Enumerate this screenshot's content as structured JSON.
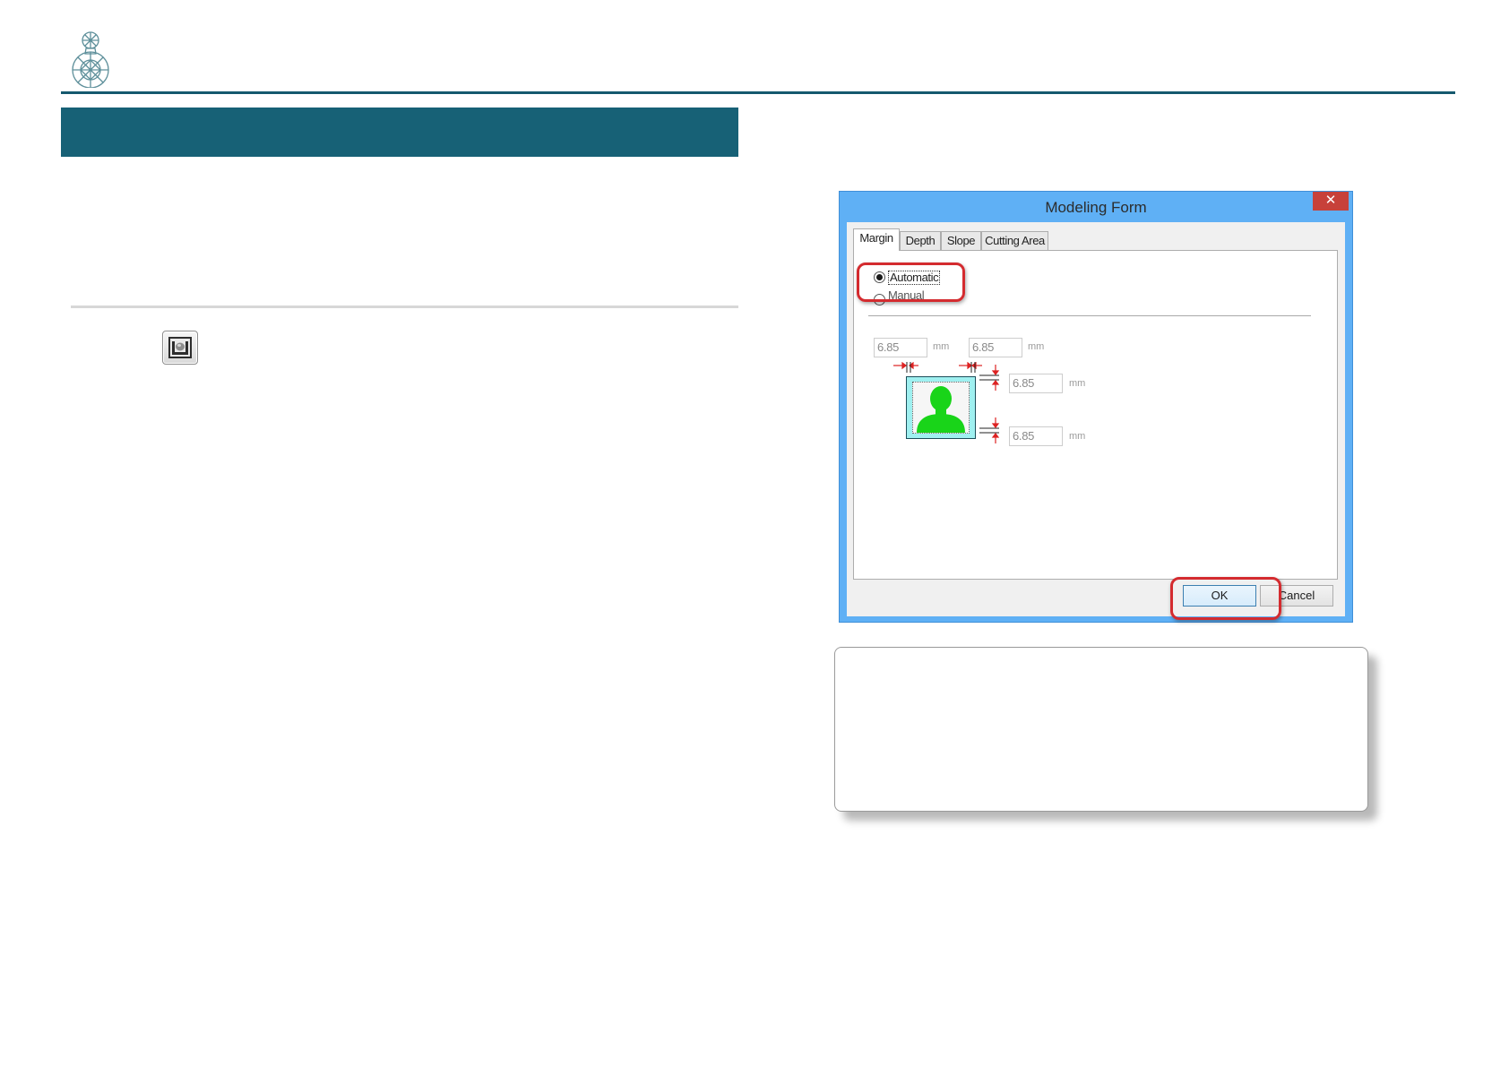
{
  "dialog": {
    "title": "Modeling Form",
    "close_glyph": "✕",
    "tabs": [
      {
        "label": "Margin",
        "active": true
      },
      {
        "label": "Depth",
        "active": false
      },
      {
        "label": "Slope",
        "active": false
      },
      {
        "label": "Cutting Area",
        "active": false
      }
    ],
    "margin_mode": {
      "automatic_label": "Automatic",
      "manual_label": "Manual",
      "selected": "Automatic"
    },
    "fields": {
      "left_margin": "6.85",
      "right_margin": "6.85",
      "top_margin": "6.85",
      "bottom_margin": "6.85"
    },
    "unit": "mm",
    "buttons": {
      "ok": "OK",
      "cancel": "Cancel"
    }
  },
  "colors": {
    "header_teal": "#176176",
    "highlight_red": "#d42b2f",
    "dialog_frame": "#5fb0f5",
    "portrait_figure": "#19d419",
    "portrait_background": "#9ff0f0"
  },
  "icons": {
    "logo": "crystal-figure-logo-icon",
    "toolbar_button": "modeling-form-icon"
  }
}
